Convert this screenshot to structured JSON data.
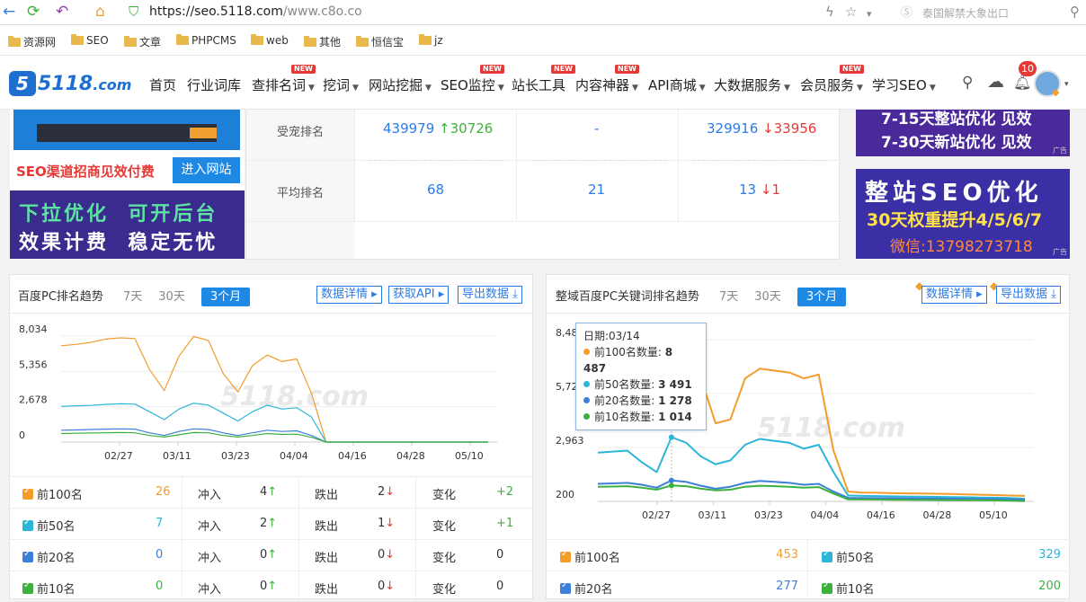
{
  "browser": {
    "url_main": "https://seo.5118.com",
    "url_path": "/www.c8o.co",
    "search_hint": "泰国解禁大象出口"
  },
  "bookmarks": [
    "资源网",
    "SEO",
    "文章",
    "PHPCMS",
    "web",
    "其他",
    "恒信宝",
    "jz"
  ],
  "nav": {
    "logo_mark": "5",
    "logo_text": "5118",
    "logo_suffix": ".com",
    "items": [
      {
        "label": "首页"
      },
      {
        "label": "行业词库"
      },
      {
        "label": "查排名词",
        "new": "NEW"
      },
      {
        "label": "挖词"
      },
      {
        "label": "网站挖掘"
      },
      {
        "label": "SEO监控",
        "new": "NEW"
      },
      {
        "label": "站长工具",
        "new": "NEW"
      },
      {
        "label": "内容神器",
        "new": "NEW"
      },
      {
        "label": "API商城"
      },
      {
        "label": "大数据服务"
      },
      {
        "label": "会员服务",
        "new": "NEW"
      },
      {
        "label": "学习SEO"
      }
    ],
    "notify_count": "10"
  },
  "ads": {
    "left_slogan": "SEO渠道招商见效付费",
    "left_button": "进入网站",
    "left_banner_line1": "下拉优化  可开后台",
    "left_banner_line2": "效果计费  稳定无忧",
    "right1_line1": "7-15天整站优化 见效",
    "right1_line2": "7-30天新站优化 见效",
    "right2_line1": "整站SEO优化",
    "right2_line2": "30天权重提升4/5/6/7",
    "right2_line3": "微信:13798273718",
    "ad_tag": "广告"
  },
  "rank_table": {
    "rows": [
      {
        "label": "受宠排名",
        "c1": "439979",
        "c1d": "30726",
        "c2": "-",
        "c3": "329916",
        "c3d": "33956"
      },
      {
        "label": "平均排名",
        "c1": "68",
        "c2": "21",
        "c3": "13",
        "c3d": "1"
      }
    ]
  },
  "left_panel": {
    "title": "百度PC排名趋势",
    "tabs": [
      "7天",
      "30天",
      "3个月"
    ],
    "buttons": [
      "数据详情",
      "获取API",
      "导出数据"
    ],
    "watermark": "5118.com",
    "stats": [
      {
        "label": "前100名",
        "count": "26",
        "in": "4",
        "out": "2",
        "change": "+2",
        "color": "#f39c2b"
      },
      {
        "label": "前50名",
        "count": "7",
        "in": "2",
        "out": "1",
        "change": "+1",
        "color": "#29b6d8"
      },
      {
        "label": "前20名",
        "count": "0",
        "in": "0",
        "out": "0",
        "change": "0",
        "color": "#3d7fd9"
      },
      {
        "label": "前10名",
        "count": "0",
        "in": "0",
        "out": "0",
        "change": "0",
        "color": "#3db13d"
      }
    ],
    "col_labels": {
      "in": "冲入",
      "out": "跌出",
      "change": "变化"
    }
  },
  "right_panel": {
    "title": "整域百度PC关键词排名趋势",
    "tabs": [
      "7天",
      "30天",
      "3个月"
    ],
    "buttons": [
      "数据详情",
      "导出数据"
    ],
    "watermark": "5118.com",
    "tooltip": {
      "date": "日期:03/14",
      "rows": [
        {
          "label": "前100名数量:",
          "value": "8 487",
          "color": "#f39c2b"
        },
        {
          "label": "前50名数量:",
          "value": "3 491",
          "color": "#29b6d8"
        },
        {
          "label": "前20名数量:",
          "value": "1 278",
          "color": "#3d7fd9"
        },
        {
          "label": "前10名数量:",
          "value": "1 014",
          "color": "#3db13d"
        }
      ]
    },
    "stats": [
      {
        "label": "前100名",
        "value": "453",
        "color": "#f39c2b"
      },
      {
        "label": "前50名",
        "value": "329",
        "color": "#29b6d8"
      },
      {
        "label": "前20名",
        "value": "277",
        "color": "#3d7fd9"
      },
      {
        "label": "前10名",
        "value": "200",
        "color": "#3db13d"
      }
    ]
  },
  "chart_data": [
    {
      "type": "line",
      "title": "百度PC排名趋势",
      "x_ticks": [
        "02/27",
        "03/11",
        "03/23",
        "04/04",
        "04/16",
        "04/28",
        "05/10"
      ],
      "y_ticks": [
        "8,034",
        "5,356",
        "2,678",
        "0"
      ],
      "ylim": [
        0,
        8034
      ],
      "series": [
        {
          "name": "前100名",
          "color": "#f39c2b",
          "values": [
            7300,
            7400,
            7550,
            7800,
            7900,
            7850,
            5500,
            3900,
            6500,
            8000,
            7700,
            5200,
            3800,
            5800,
            6600,
            6100,
            6300,
            3700,
            0,
            0,
            0,
            0,
            0,
            0,
            0,
            0,
            0,
            0,
            0,
            0
          ]
        },
        {
          "name": "前50名",
          "color": "#29b6d8",
          "values": [
            2700,
            2750,
            2780,
            2850,
            2900,
            2880,
            2300,
            1700,
            2500,
            2950,
            2800,
            2200,
            1600,
            2300,
            2800,
            2500,
            2600,
            1900,
            0,
            0,
            0,
            0,
            0,
            0,
            0,
            0,
            0,
            0,
            0,
            0
          ]
        },
        {
          "name": "前20名",
          "color": "#3d7fd9",
          "values": [
            900,
            920,
            950,
            980,
            1000,
            980,
            700,
            500,
            800,
            1000,
            950,
            700,
            500,
            700,
            900,
            800,
            850,
            500,
            0,
            0,
            0,
            0,
            0,
            0,
            0,
            0,
            0,
            0,
            0,
            0
          ]
        },
        {
          "name": "前10名",
          "color": "#3db13d",
          "values": [
            650,
            670,
            690,
            700,
            720,
            700,
            500,
            380,
            550,
            720,
            700,
            500,
            380,
            500,
            650,
            580,
            600,
            360,
            0,
            0,
            0,
            0,
            0,
            0,
            0,
            0,
            0,
            0,
            0,
            0
          ]
        }
      ]
    },
    {
      "type": "line",
      "title": "整域百度PC关键词排名趋势",
      "x_ticks": [
        "02/27",
        "03/11",
        "03/23",
        "04/04",
        "04/16",
        "04/28",
        "05/10"
      ],
      "y_ticks": [
        "8,48",
        "5,72",
        "2,963",
        "200"
      ],
      "ylim": [
        200,
        8487
      ],
      "series": [
        {
          "name": "前100名",
          "color": "#f39c2b",
          "values": [
            5000,
            5100,
            5200,
            4300,
            6300,
            8487,
            8400,
            6500,
            4200,
            4400,
            6500,
            7000,
            6900,
            6800,
            6500,
            6700,
            2800,
            700,
            650,
            640,
            620,
            610,
            600,
            590,
            580,
            560,
            540,
            520,
            500,
            480
          ]
        },
        {
          "name": "前50名",
          "color": "#29b6d8",
          "values": [
            2700,
            2750,
            2800,
            2200,
            1700,
            3491,
            3200,
            2500,
            2100,
            2300,
            3100,
            3400,
            3300,
            3200,
            2900,
            3100,
            1700,
            500,
            480,
            470,
            460,
            450,
            440,
            430,
            420,
            410,
            400,
            390,
            370,
            340
          ]
        },
        {
          "name": "前20名",
          "color": "#3d7fd9",
          "values": [
            1100,
            1120,
            1150,
            1050,
            900,
            1278,
            1200,
            1000,
            850,
            950,
            1150,
            1250,
            1200,
            1150,
            1050,
            1100,
            700,
            380,
            370,
            365,
            360,
            355,
            350,
            345,
            340,
            335,
            330,
            320,
            300,
            280
          ]
        },
        {
          "name": "前10名",
          "color": "#3db13d",
          "values": [
            950,
            960,
            980,
            900,
            800,
            1014,
            980,
            850,
            760,
            800,
            950,
            1000,
            980,
            950,
            900,
            930,
            600,
            300,
            295,
            290,
            285,
            280,
            275,
            270,
            265,
            260,
            255,
            250,
            230,
            210
          ]
        }
      ]
    }
  ]
}
